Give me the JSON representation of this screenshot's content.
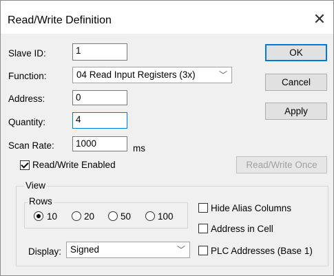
{
  "window": {
    "title": "Read/Write Definition",
    "close_glyph": "✕"
  },
  "form": {
    "slave_id_label": "Slave ID:",
    "slave_id_value": "1",
    "function_label": "Function:",
    "function_value": "04 Read Input Registers (3x)",
    "address_label": "Address:",
    "address_value": "0",
    "quantity_label": "Quantity:",
    "quantity_value": "4",
    "scan_rate_label": "Scan Rate:",
    "scan_rate_value": "1000",
    "scan_rate_unit": "ms",
    "rw_enabled_label": "Read/Write Enabled"
  },
  "buttons": {
    "ok": "OK",
    "cancel": "Cancel",
    "apply": "Apply",
    "rw_once": "Read/Write Once"
  },
  "view": {
    "group_label": "View",
    "rows_label": "Rows",
    "rows_options": [
      "10",
      "20",
      "50",
      "100"
    ],
    "rows_selected": "10",
    "display_label": "Display:",
    "display_value": "Signed",
    "hide_alias_label": "Hide Alias Columns",
    "address_in_cell_label": "Address in Cell",
    "plc_addresses_label": "PLC Addresses (Base 1)"
  }
}
